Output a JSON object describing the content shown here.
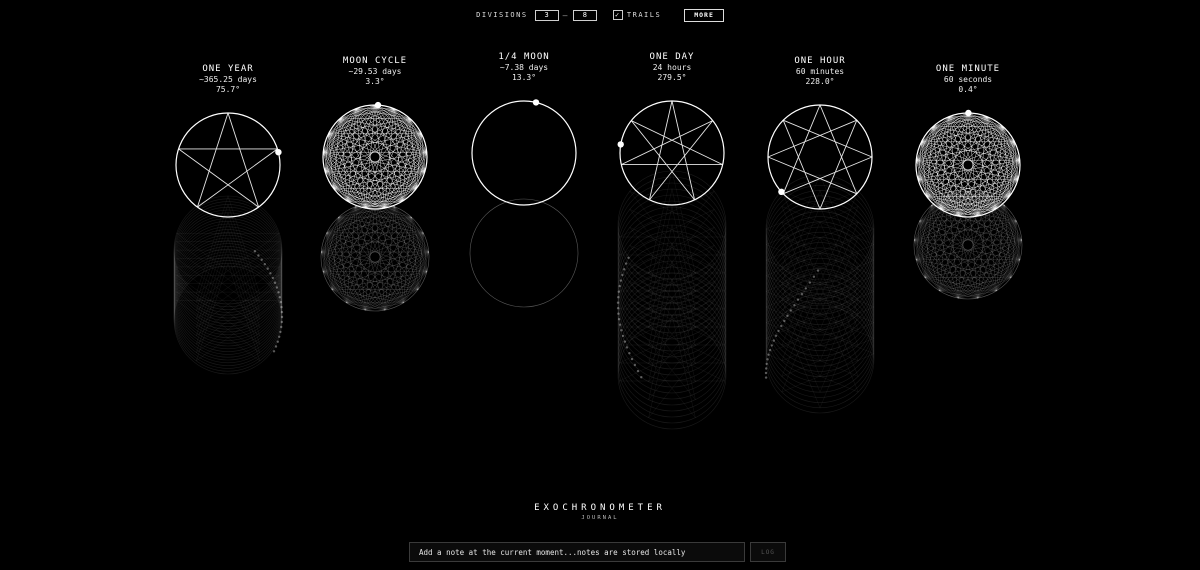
{
  "controls": {
    "divisions_label": "DIVISIONS",
    "divisions_min": "3",
    "divisions_sep": "–",
    "divisions_max": "8",
    "trails_checked": true,
    "trails_label": "TRAILS",
    "more_label": "MORE"
  },
  "clocks": [
    {
      "title": "ONE YEAR",
      "period": "~365.25 days",
      "angle": "75.7°",
      "angle_deg": 75.7,
      "divisions": 5,
      "step": 2
    },
    {
      "title": "MOON CYCLE",
      "period": "~29.53 days",
      "angle": "3.3°",
      "angle_deg": 3.3,
      "divisions": 17,
      "step": 6
    },
    {
      "title": "1/4 MOON",
      "period": "~7.38 days",
      "angle": "13.3°",
      "angle_deg": 13.3,
      "divisions": 0,
      "step": 0
    },
    {
      "title": "ONE DAY",
      "period": "24 hours",
      "angle": "279.5°",
      "angle_deg": 279.5,
      "divisions": 7,
      "step": 3
    },
    {
      "title": "ONE HOUR",
      "period": "60 minutes",
      "angle": "228.0°",
      "angle_deg": 228.0,
      "divisions": 8,
      "step": 3
    },
    {
      "title": "ONE MINUTE",
      "period": "60 seconds",
      "angle": "0.4°",
      "angle_deg": 0.4,
      "divisions": 17,
      "step": 5
    }
  ],
  "footer": {
    "app_name": "EXOCHRONOMETER",
    "subtitle": "JOURNAL"
  },
  "journal": {
    "placeholder": "Add a note at the current moment...notes are stored locally",
    "log_label": "LOG"
  },
  "colors": {
    "background": "#000000",
    "foreground": "#ffffff"
  }
}
